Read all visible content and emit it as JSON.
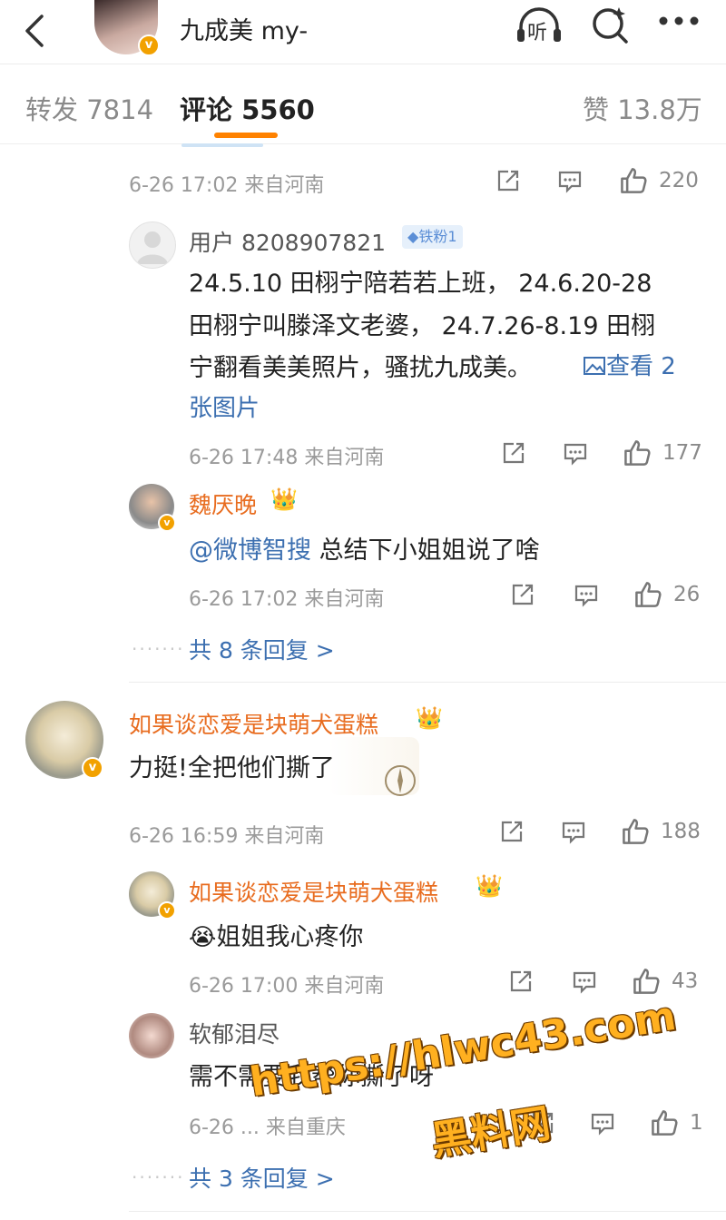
{
  "header": {
    "user_name": "九成美 my-",
    "listen_label": "听"
  },
  "tabs": {
    "repost": "转发 7814",
    "comments": "评论 5560",
    "likes": "赞 13.8万"
  },
  "thread1": {
    "parent_meta": "6-26 17:02 来自河南",
    "parent_likes": "220",
    "reply1": {
      "user": "用户 8208907821",
      "badge": "铁粉1",
      "line1": "24.5.10 田栩宁陪若若上班， 24.6.20-28",
      "line2": "田栩宁叫滕泽文老婆， 24.7.26-8.19 田栩",
      "line3": "宁翻看美美照片，骚扰九成美。",
      "link_text": "查看 2",
      "line4": "张图片",
      "meta": "6-26 17:48 来自河南",
      "likes": "177"
    },
    "reply2": {
      "user": "魏厌晚",
      "mention": "@微博智搜",
      "text": " 总结下小姐姐说了啥",
      "meta": "6-26 17:02 来自河南",
      "likes": "26"
    },
    "more_replies": "共 8 条回复 >"
  },
  "thread2": {
    "user": "如果谈恋爱是块萌犬蛋糕",
    "text": "力挺!全把他们撕了",
    "meta": "6-26 16:59 来自河南",
    "likes": "188",
    "reply1": {
      "user": "如果谈恋爱是块萌犬蛋糕",
      "text": "姐姐我心疼你",
      "meta": "6-26 17:00 来自河南",
      "likes": "43"
    },
    "reply2": {
      "user": "软郁泪尽",
      "text": "需不需要我帮你撕了呀",
      "meta": "6-26 ... 来自重庆",
      "likes": "1"
    },
    "more_replies": "共 3 条回复 >"
  },
  "watermark": {
    "url": "https://hlwc43.com",
    "label": "黑料网"
  },
  "colors": {
    "accent": "#ff8200",
    "name_orange": "#e86c1f",
    "link_blue": "#3c6fb0"
  }
}
